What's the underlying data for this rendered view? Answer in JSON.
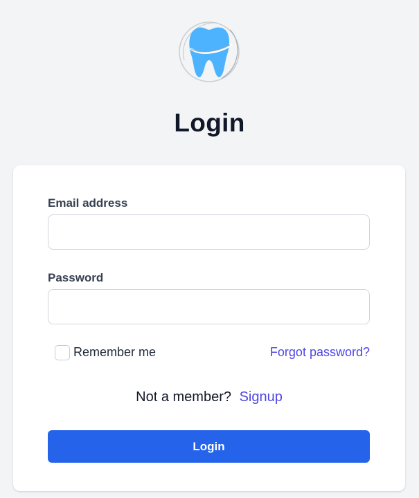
{
  "logo": {
    "icon": "tooth-logo-icon",
    "colors": {
      "tooth": "#4db3ff",
      "ring": "#c9ccd1",
      "smile": "#ffffff"
    }
  },
  "page": {
    "title": "Login"
  },
  "form": {
    "email_label": "Email address",
    "email_value": "",
    "password_label": "Password",
    "password_value": "",
    "remember_label": "Remember me",
    "remember_checked": false,
    "forgot_label": "Forgot password?",
    "signup_prompt": "Not a member?",
    "signup_label": "Signup",
    "submit_label": "Login"
  },
  "colors": {
    "background": "#f3f4f6",
    "card": "#ffffff",
    "primary_button": "#2563eb",
    "link": "#4f46e5",
    "heading": "#111827"
  }
}
